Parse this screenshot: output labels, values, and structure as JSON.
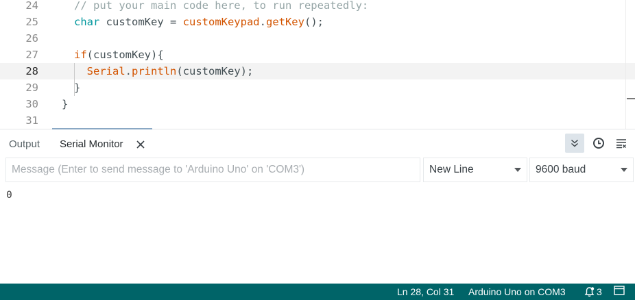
{
  "editor": {
    "current_line": "28",
    "lines": [
      {
        "num": "24",
        "tokens": [
          {
            "t": "// put your main code here, to run repeatedly:",
            "c": "comment"
          }
        ]
      },
      {
        "num": "25",
        "tokens": [
          {
            "t": "char",
            "c": "type"
          },
          {
            "t": " customKey = ",
            "c": "plain"
          },
          {
            "t": "customKeypad",
            "c": "fn"
          },
          {
            "t": ".",
            "c": "plain"
          },
          {
            "t": "getKey",
            "c": "fn"
          },
          {
            "t": "();",
            "c": "plain"
          }
        ]
      },
      {
        "num": "26",
        "tokens": []
      },
      {
        "num": "27",
        "tokens": [
          {
            "t": "if",
            "c": "fn"
          },
          {
            "t": "(customKey){",
            "c": "plain"
          }
        ]
      },
      {
        "num": "28",
        "tokens": [
          {
            "t": "  ",
            "c": "plain"
          },
          {
            "t": "Serial",
            "c": "fn"
          },
          {
            "t": ".",
            "c": "plain"
          },
          {
            "t": "println",
            "c": "fn"
          },
          {
            "t": "(customKey);",
            "c": "plain"
          }
        ]
      },
      {
        "num": "29",
        "tokens": [
          {
            "t": "}",
            "c": "plain"
          }
        ]
      },
      {
        "num": "30",
        "tokens": [
          {
            "t": "}",
            "c": "plain"
          }
        ]
      },
      {
        "num": "31",
        "tokens": []
      }
    ]
  },
  "panel": {
    "tabs": {
      "output": "Output",
      "serial_monitor": "Serial Monitor"
    },
    "message_placeholder": "Message (Enter to send message to 'Arduino Uno' on 'COM3')",
    "line_ending": "New Line",
    "baud_rate": "9600 baud",
    "output_text": "0"
  },
  "status": {
    "position": "Ln 28, Col 31",
    "board": "Arduino Uno on COM3",
    "notifications": "3"
  },
  "colors": {
    "statusbar_bg": "#006468",
    "keyword_teal": "#00979d",
    "function_orange": "#d35400",
    "comment_gray": "#95a5a6"
  },
  "icons": {
    "autoscroll": "chevrons-down-icon",
    "timestamp": "clock-icon",
    "clear": "clear-output-icon",
    "close": "close-icon",
    "notifications": "bell-icon",
    "toggle_panel": "panel-layout-icon"
  }
}
